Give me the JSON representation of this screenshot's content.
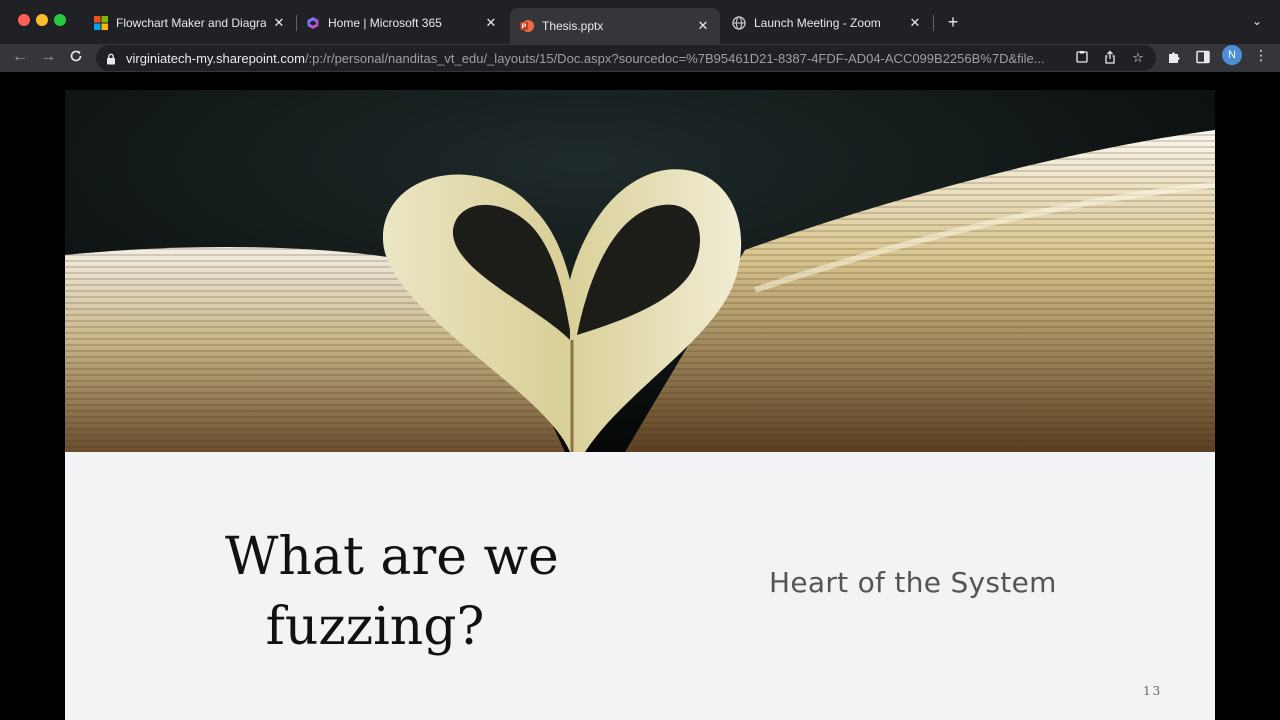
{
  "browser": {
    "tabs": [
      {
        "title": "Flowchart Maker and Diagramming",
        "icon": "microsoft-icon"
      },
      {
        "title": "Home | Microsoft 365",
        "icon": "microsoft365-icon"
      },
      {
        "title": "Thesis.pptx",
        "icon": "powerpoint-icon",
        "active": true
      },
      {
        "title": "Launch Meeting - Zoom",
        "icon": "globe-icon"
      }
    ],
    "new_tab_label": "+",
    "url_host": "virginiatech-my.sharepoint.com",
    "url_path": "/:p:/r/personal/nanditas_vt_edu/_layouts/15/Doc.aspx?sourcedoc=%7B95461D21-8387-4FDF-AD04-ACC099B2256B%7D&file...",
    "profile_initial": "N"
  },
  "slide": {
    "title_line1": "What are we",
    "title_line2": "fuzzing?",
    "subtitle": "Heart of the System",
    "number": "13"
  },
  "colors": {
    "tabstrip": "#202124",
    "toolbar": "#35363a",
    "slide_background": "#f2f3f4",
    "profile": "#4b8fd6"
  }
}
